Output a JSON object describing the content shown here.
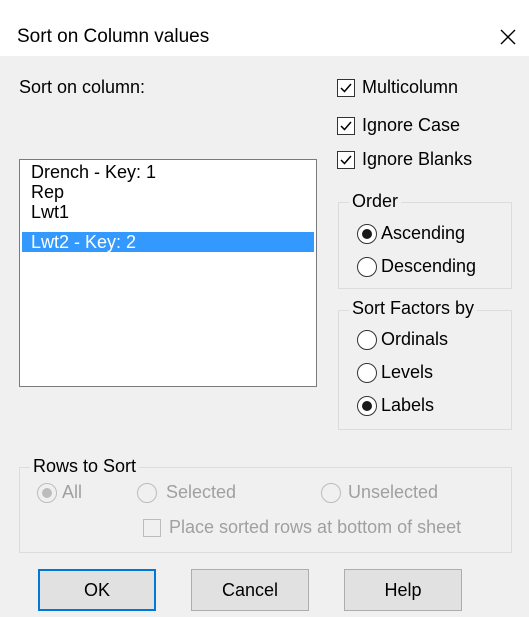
{
  "dialog": {
    "title": "Sort on Column values"
  },
  "sort_column": {
    "label": "Sort on column:",
    "items": [
      {
        "label": "Drench - Key: 1",
        "selected": false
      },
      {
        "label": "Rep",
        "selected": false
      },
      {
        "label": "Lwt1",
        "selected": false
      },
      {
        "label": "Lwt2 - Key: 2",
        "selected": true
      }
    ]
  },
  "options": {
    "multicolumn": {
      "label": "Multicolumn",
      "checked": true
    },
    "ignore_case": {
      "label": "Ignore Case",
      "checked": true
    },
    "ignore_blanks": {
      "label": "Ignore Blanks",
      "checked": true
    }
  },
  "order": {
    "legend": "Order",
    "options": [
      {
        "label": "Ascending",
        "selected": true
      },
      {
        "label": "Descending",
        "selected": false
      }
    ]
  },
  "sort_factors": {
    "legend": "Sort Factors by",
    "options": [
      {
        "label": "Ordinals",
        "selected": false
      },
      {
        "label": "Levels",
        "selected": false
      },
      {
        "label": "Labels",
        "selected": true
      }
    ]
  },
  "rows_to_sort": {
    "legend": "Rows to Sort",
    "options": [
      {
        "label": "All",
        "selected": true
      },
      {
        "label": "Selected",
        "selected": false
      },
      {
        "label": "Unselected",
        "selected": false
      }
    ],
    "bottom_checkbox": {
      "label": "Place sorted rows at bottom of sheet",
      "checked": false
    }
  },
  "buttons": {
    "ok": "OK",
    "cancel": "Cancel",
    "help": "Help"
  },
  "colors": {
    "selection": "#3399ff",
    "default_button_border": "#0078d7",
    "dialog_bg": "#f0f0f0"
  }
}
